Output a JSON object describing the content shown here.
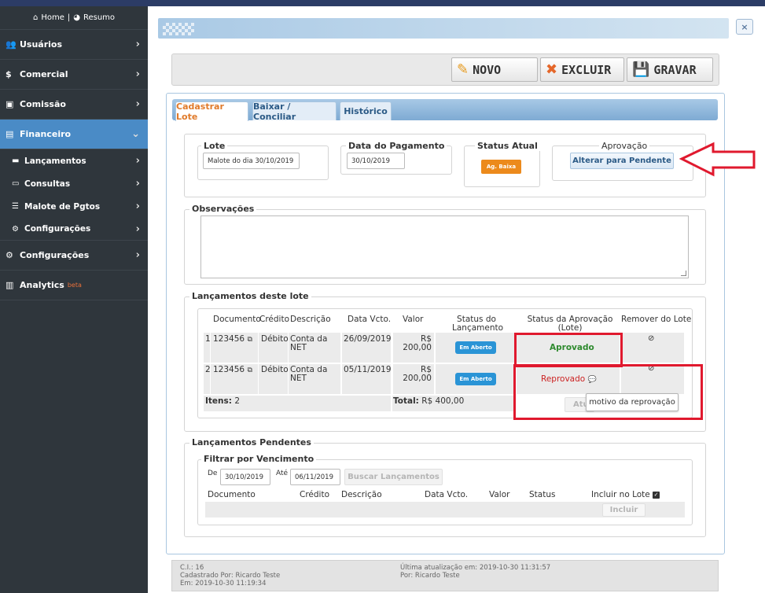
{
  "sidebar": {
    "home_label": "Home",
    "resumo_label": "Resumo",
    "items": [
      {
        "label": "Usuários"
      },
      {
        "label": "Comercial"
      },
      {
        "label": "Comissão"
      },
      {
        "label": "Financeiro"
      },
      {
        "label": "Configurações"
      },
      {
        "label": "Analytics",
        "badge": "beta"
      }
    ],
    "financeiro_sub": [
      {
        "label": "Lançamentos"
      },
      {
        "label": "Consultas"
      },
      {
        "label": "Malote de Pgtos"
      },
      {
        "label": "Configurações"
      }
    ]
  },
  "toolbar": {
    "novo": "NOVO",
    "excluir": "EXCLUIR",
    "gravar": "GRAVAR"
  },
  "close_label": "×",
  "tabs": [
    {
      "label": "Cadastrar Lote"
    },
    {
      "label": "Baixar / Conciliar"
    },
    {
      "label": "Histórico"
    }
  ],
  "lote": {
    "lote_legend": "Lote",
    "lote_value": "Malote do dia 30/10/2019",
    "data_legend": "Data do Pagamento",
    "data_value": "30/10/2019",
    "status_legend": "Status Atual",
    "status_badge": "Ag. Baixa",
    "aprovacao_legend": "Aprovação",
    "aprovacao_button": "Alterar para Pendente"
  },
  "observacoes": {
    "legend": "Observações",
    "value": ""
  },
  "lancamentos": {
    "legend": "Lançamentos deste lote",
    "headers": {
      "documento": "Documento",
      "credito": "Crédito",
      "descricao": "Descrição",
      "data_vcto": "Data Vcto.",
      "valor": "Valor",
      "status_lanc_1": "Status do",
      "status_lanc_2": "Lançamento",
      "status_aprov_1": "Status da Aprovação",
      "status_aprov_2": "(Lote)",
      "remover": "Remover do Lote"
    },
    "rows": [
      {
        "num": "1",
        "documento": "123456",
        "credito": "Débito",
        "descricao_1": "Conta da",
        "descricao_2": "NET",
        "data_vcto": "26/09/2019",
        "valor_1": "R$",
        "valor_2": "200,00",
        "status": "Em Aberto",
        "aprovacao": "Aprovado"
      },
      {
        "num": "2",
        "documento": "123456",
        "credito": "Débito",
        "descricao_1": "Conta da",
        "descricao_2": "NET",
        "data_vcto": "05/11/2019",
        "valor_1": "R$",
        "valor_2": "200,00",
        "status": "Em Aberto",
        "aprovacao": "Reprovado"
      }
    ],
    "itens_label": "Itens:",
    "itens_value": "2",
    "total_label": "Total:",
    "total_value": "R$ 400,00",
    "hidden_button_fragment": "Atu",
    "tooltip": "motivo da reprovação"
  },
  "pendentes": {
    "legend": "Lançamentos Pendentes",
    "filtro_legend": "Filtrar por Vencimento",
    "de_label": "De",
    "de_value": "30/10/2019",
    "ate_label": "Até",
    "ate_value": "06/11/2019",
    "buscar_button": "Buscar Lançamentos",
    "headers": {
      "documento": "Documento",
      "credito": "Crédito",
      "descricao": "Descrição",
      "data_vcto": "Data Vcto.",
      "valor": "Valor",
      "status": "Status",
      "incluir": "Incluir no Lote"
    },
    "incluir_button": "Incluir"
  },
  "footer": {
    "ci": "C.I.: 16",
    "cadastrado_por": "Cadastrado Por: Ricardo Teste",
    "em": "Em: 2019-10-30 11:19:34",
    "ultima": "Última atualização em: 2019-10-30 11:31:57",
    "por": "Por: Ricardo Teste"
  },
  "colors": {
    "accent": "#4a8bc6",
    "status_badge_orange": "#ec8a1c",
    "em_aberto_blue": "#2a94d6",
    "approved_green": "#2e8a2e",
    "rejected_red": "#cc2222",
    "highlight_red": "#e0192e"
  }
}
